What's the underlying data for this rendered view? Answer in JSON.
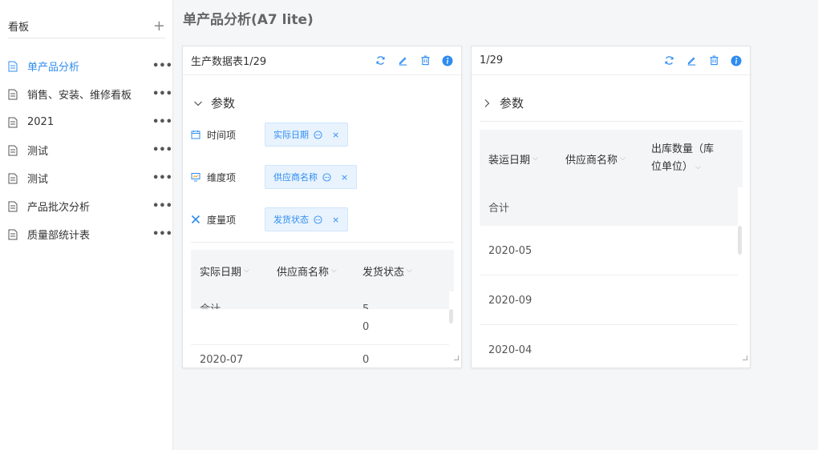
{
  "sidebar": {
    "title": "看板",
    "add_icon": "plus-icon",
    "items": [
      {
        "label": "单产品分析",
        "active": true
      },
      {
        "label": "销售、安装、维修看板",
        "active": false
      },
      {
        "label": "2021",
        "active": false
      },
      {
        "label": "测试",
        "active": false
      },
      {
        "label": "测试",
        "active": false
      },
      {
        "label": "产品批次分析",
        "active": false
      },
      {
        "label": "质量部统计表",
        "active": false
      }
    ],
    "more_label": "•••"
  },
  "page": {
    "title": "单产品分析(A7 lite)"
  },
  "colors": {
    "accent": "#2f8cf0",
    "chip_bg": "#e8f3fe",
    "header_bg": "#f4f5f7"
  },
  "panel1": {
    "title": "生产数据表1/29",
    "section": "参数",
    "params": [
      {
        "label": "时间项",
        "chip": "实际日期",
        "icon": "calendar-icon"
      },
      {
        "label": "维度项",
        "chip": "供应商名称",
        "icon": "dimension-icon"
      },
      {
        "label": "度量项",
        "chip": "发货状态",
        "icon": "measure-icon"
      }
    ],
    "chip_close": "×",
    "table": {
      "columns": [
        "实际日期",
        "供应商名称",
        "发货状态"
      ],
      "sum_label": "合计",
      "sum_value": "5",
      "row1_value": "0",
      "row2_date": "2020-07",
      "row2_value": "0"
    }
  },
  "panel2": {
    "title": "1/29",
    "section": "参数",
    "table": {
      "columns": [
        "装运日期",
        "供应商名称",
        "出库数量（库",
        "位单位）"
      ],
      "sum_label": "合计",
      "rows": [
        "2020-05",
        "2020-09",
        "2020-04"
      ]
    }
  }
}
